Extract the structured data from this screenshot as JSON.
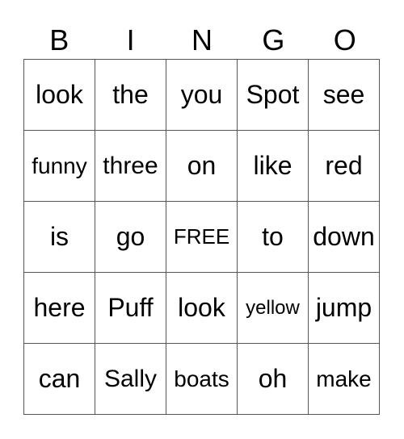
{
  "header": [
    "B",
    "I",
    "N",
    "G",
    "O"
  ],
  "rows": [
    [
      "look",
      "the",
      "you",
      "Spot",
      "see"
    ],
    [
      "funny",
      "three",
      "on",
      "like",
      "red"
    ],
    [
      "is",
      "go",
      "FREE",
      "to",
      "down"
    ],
    [
      "here",
      "Puff",
      "look",
      "yellow",
      "jump"
    ],
    [
      "can",
      "Sally",
      "boats",
      "oh",
      "make"
    ]
  ]
}
